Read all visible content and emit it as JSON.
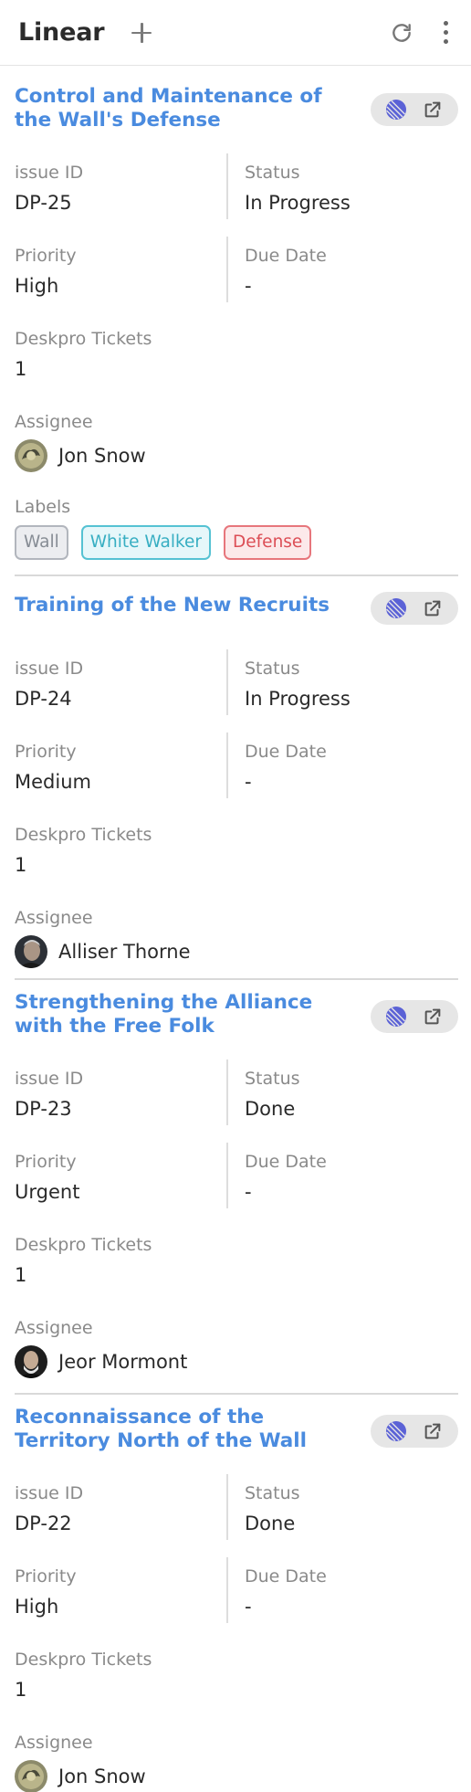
{
  "app": {
    "title": "Linear"
  },
  "fields": {
    "issue_id": "issue ID",
    "status": "Status",
    "priority": "Priority",
    "due_date": "Due Date",
    "tickets": "Deskpro Tickets",
    "assignee": "Assignee",
    "labels": "Labels"
  },
  "issues": [
    {
      "title": "Control and Maintenance of the Wall's Defense",
      "id": "DP-25",
      "status": "In Progress",
      "priority": "High",
      "due_date": "-",
      "tickets": "1",
      "assignee": "Jon Snow",
      "labels": [
        "Wall",
        "White Walker",
        "Defense"
      ]
    },
    {
      "title": "Training of the New Recruits",
      "id": "DP-24",
      "status": "In Progress",
      "priority": "Medium",
      "due_date": "-",
      "tickets": "1",
      "assignee": "Alliser Thorne"
    },
    {
      "title": "Strengthening the Alliance with the Free Folk",
      "id": "DP-23",
      "status": "Done",
      "priority": "Urgent",
      "due_date": "-",
      "tickets": "1",
      "assignee": "Jeor Mormont"
    },
    {
      "title": "Reconnaissance of the Territory North of the Wall",
      "id": "DP-22",
      "status": "Done",
      "priority": "High",
      "due_date": "-",
      "tickets": "1",
      "assignee": "Jon Snow"
    }
  ],
  "colors": {
    "title_link": "#4a8bdf",
    "linear_icon": "#5b62d6",
    "label_wall": "#868c94",
    "label_white_walker": "#37aec2",
    "label_defense": "#dc4e56"
  },
  "icons": [
    "plus-icon",
    "refresh-icon",
    "kebab-menu-icon",
    "linear-logo-icon",
    "external-link-icon"
  ]
}
